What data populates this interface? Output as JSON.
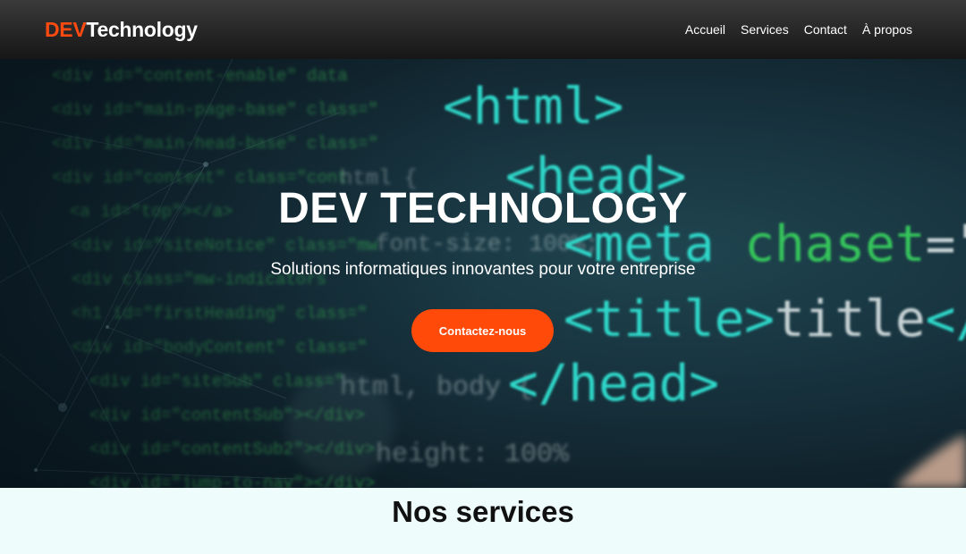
{
  "brand": {
    "logo_accent": "DEV",
    "logo_rest": "Technology",
    "accent_color": "#ff4a10"
  },
  "nav": {
    "items": [
      {
        "label": "Accueil"
      },
      {
        "label": "Services"
      },
      {
        "label": "Contact"
      },
      {
        "label": "À propos"
      }
    ]
  },
  "hero": {
    "title": "DEV TECHNOLOGY",
    "subtitle": "Solutions informatiques innovantes pour votre entreprise",
    "cta_label": "Contactez-nous",
    "cta_color": "#ff4a0a",
    "background_code": {
      "tags": [
        "<html>",
        "<head>",
        "<meta chaset=\"UTF",
        "<title>title</title>",
        "</head>"
      ],
      "code_lines": [
        "<div id=\"content-enable\" data",
        "<div id=\"main-page-base\" class=\"",
        "<div id=\"main-head-base\" class=\"",
        "<div id=\"content\" class=\"cont",
        "<a id=\"top\"></a>",
        "<div id=\"siteNotice\" class=\"mw",
        "<div class=\"mw-indicators",
        "<h1 id=\"firstHeading\" class=\"",
        "<div id=\"bodyContent\" class=\"",
        "<div id=\"siteSub\" class=\"",
        "<div id=\"contentSub\"></div>",
        "<div id=\"contentSub2\"></div>",
        "<div id=\"jump-to-nav\"></div>"
      ],
      "snippets": [
        "html {",
        "font-size: 100%;",
        "html, body {",
        "height: 100%"
      ]
    }
  },
  "services": {
    "title": "Nos services"
  }
}
